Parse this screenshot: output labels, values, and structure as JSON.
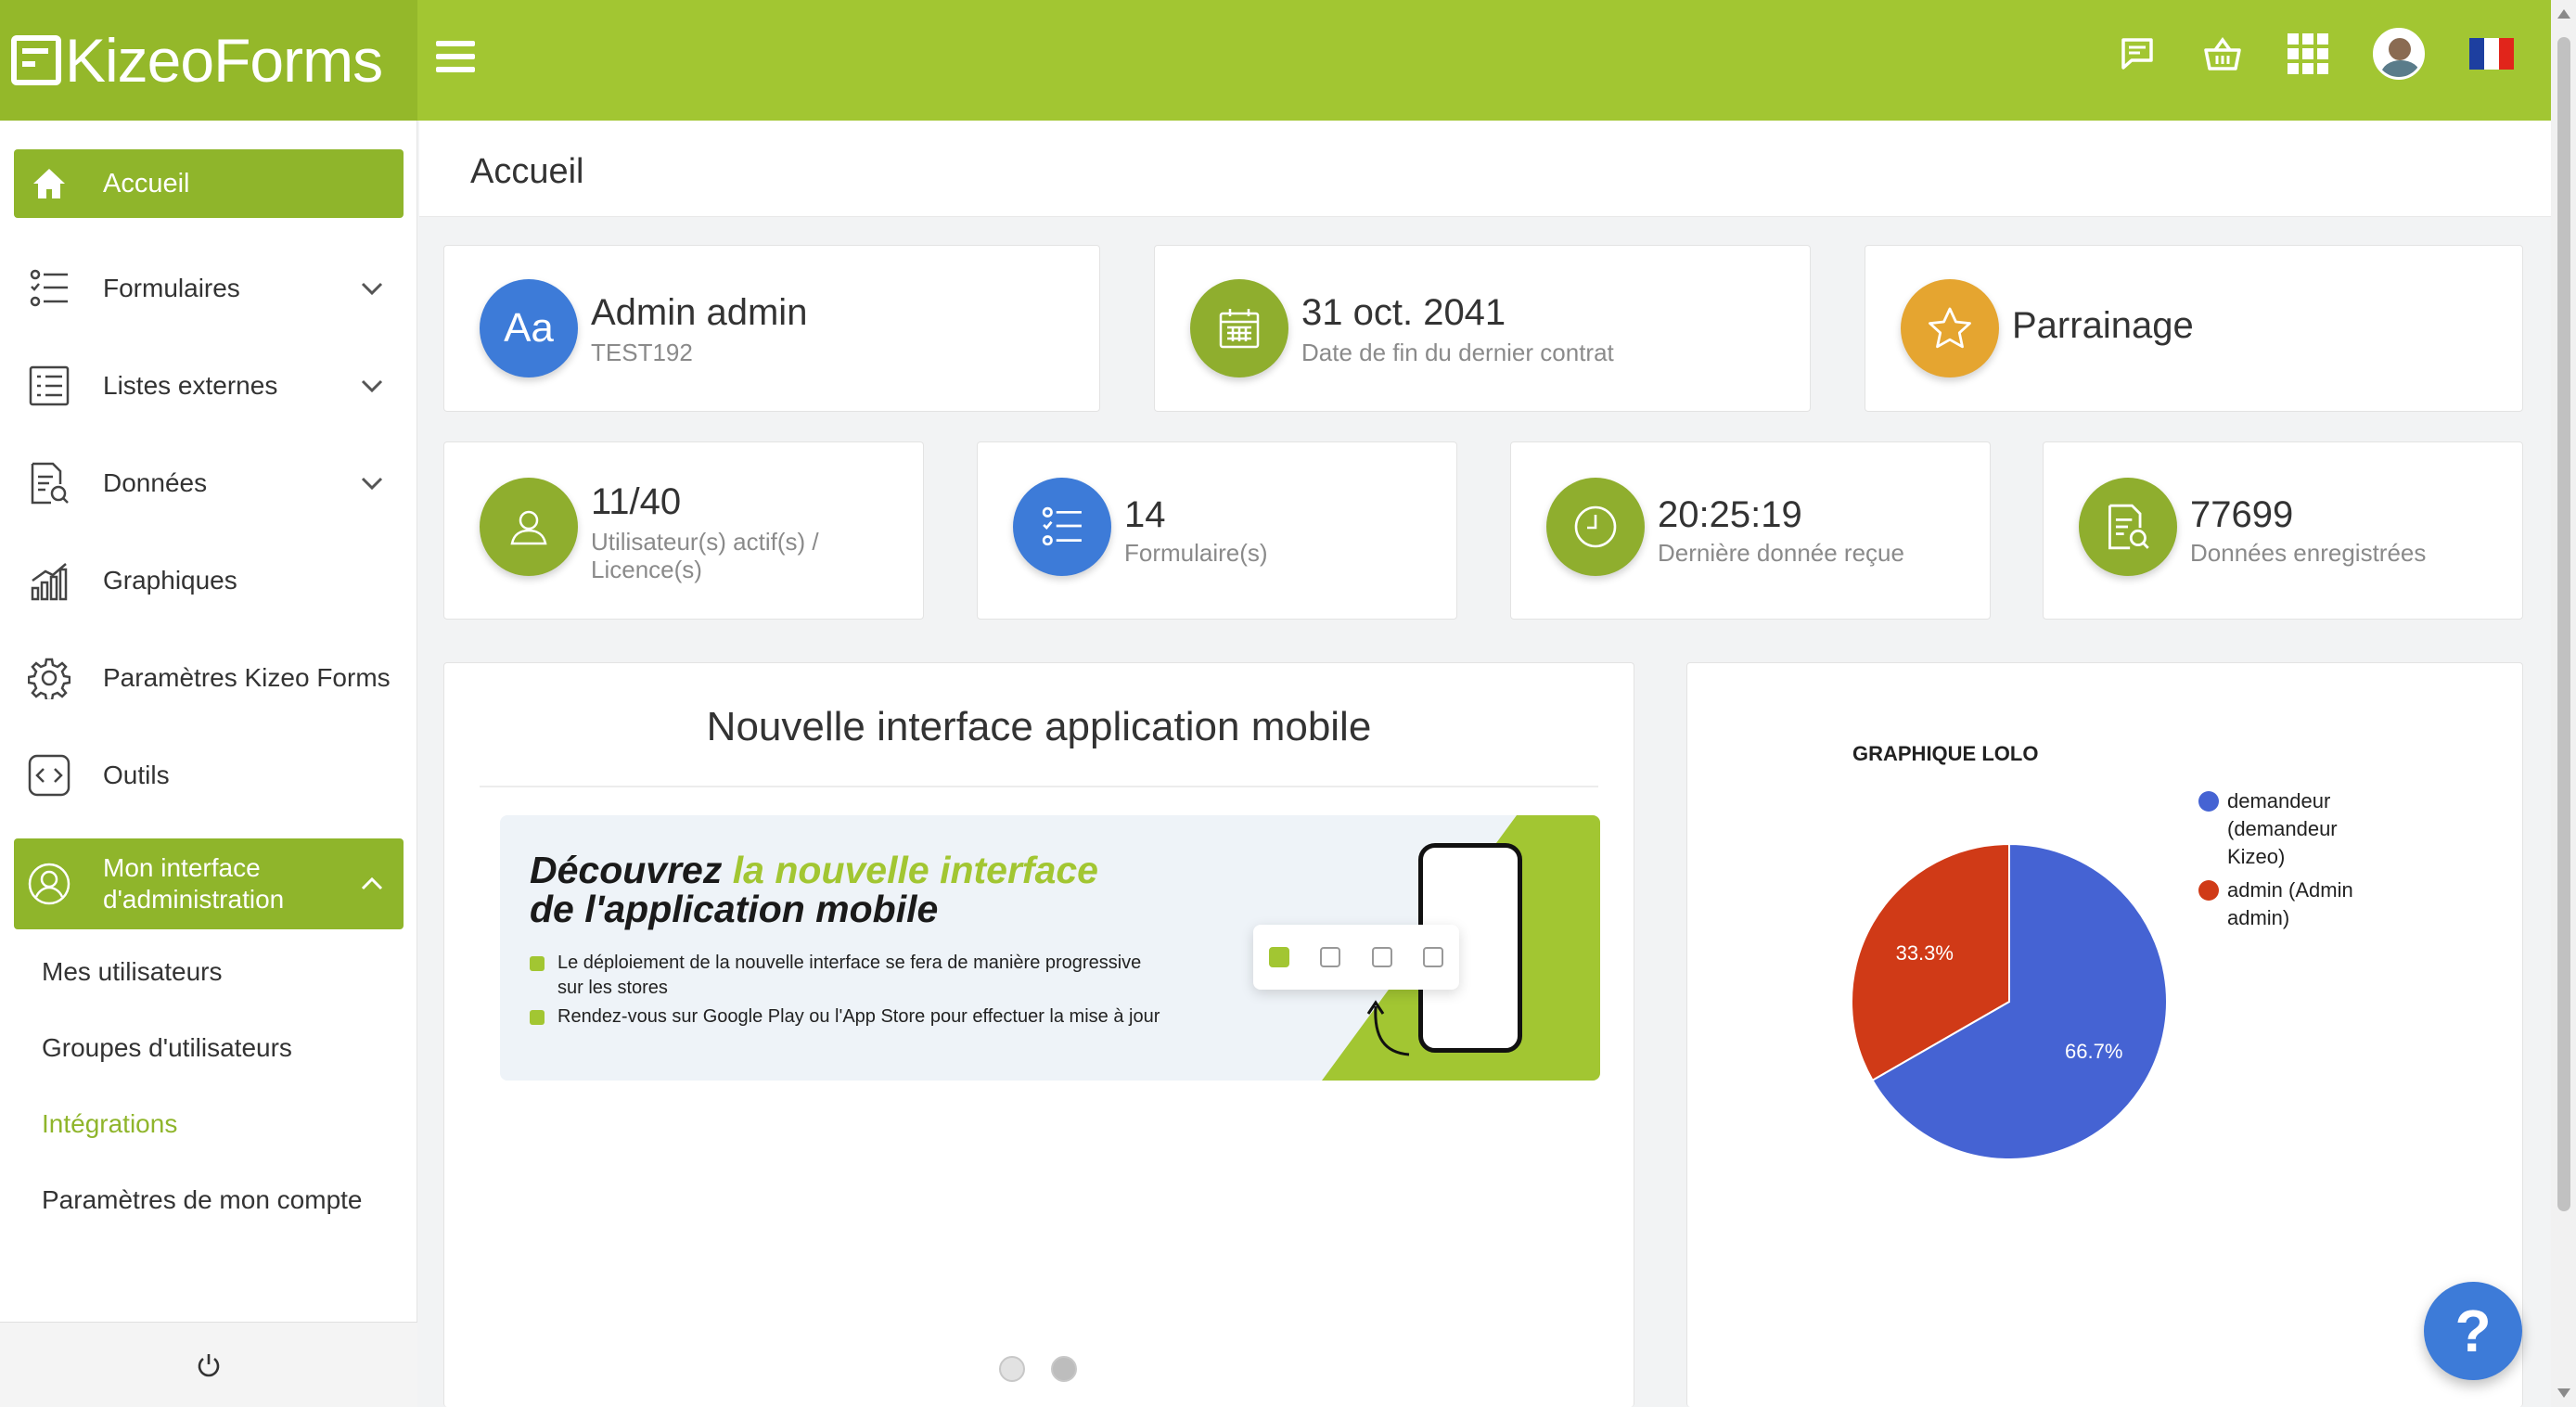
{
  "app": {
    "logo_text": "KizeoForms"
  },
  "header": {
    "icons": [
      "chat-icon",
      "basket-icon",
      "apps-grid-icon",
      "user-avatar",
      "france-flag-icon"
    ],
    "accent": "#a2c632"
  },
  "sidebar": {
    "active_item": "Accueil",
    "items": [
      {
        "label": "Formulaires",
        "icon": "forms-list-icon"
      },
      {
        "label": "Listes externes",
        "icon": "list-icon"
      },
      {
        "label": "Données",
        "icon": "document-search-icon"
      },
      {
        "label": "Graphiques",
        "icon": "bar-chart-icon"
      },
      {
        "label": "Paramètres Kizeo Forms",
        "icon": "gear-icon"
      },
      {
        "label": "Outils",
        "icon": "code-icon"
      }
    ],
    "admin_label_line1": "Mon interface",
    "admin_label_line2": "d'administration",
    "sub_items": [
      "Mes utilisateurs",
      "Groupes d'utilisateurs",
      "Intégrations",
      "Paramètres de mon compte"
    ]
  },
  "page": {
    "title": "Accueil"
  },
  "cards": {
    "user": {
      "avatar_text": "Aa",
      "name": "Admin admin",
      "sub": "TEST192"
    },
    "contract": {
      "date": "31 oct. 2041",
      "sub": "Date de fin du dernier contrat"
    },
    "referral": {
      "label": "Parrainage"
    },
    "users": {
      "value": "11/40",
      "sub_line1": "Utilisateur(s) actif(s) /",
      "sub_line2": "Licence(s)"
    },
    "forms": {
      "value": "14",
      "sub": "Formulaire(s)"
    },
    "last_data": {
      "value": "20:25:19",
      "sub": "Dernière donnée reçue"
    },
    "data_count": {
      "value": "77699",
      "sub": "Données enregistrées"
    }
  },
  "banner": {
    "title": "Nouvelle interface application mobile",
    "headline_part1": "Découvrez ",
    "headline_green": "la nouvelle interface",
    "headline_line2": "de l'application mobile",
    "bullet1_line1": "Le déploiement de la nouvelle interface se fera de manière progressive",
    "bullet1_line2": "sur les stores",
    "bullet2": "Rendez-vous sur Google Play ou l'App Store pour effectuer la mise à jour",
    "carousel_count": 2,
    "carousel_active": 2
  },
  "chart_data": {
    "type": "pie",
    "title": "GRAPHIQUE LOLO",
    "legend_position": "right",
    "slices": [
      {
        "name": "demandeur (demandeur Kizeo)",
        "value": 66.7,
        "label": "66.7%",
        "color": "#4563d3"
      },
      {
        "name": "admin (Admin admin)",
        "value": 33.3,
        "label": "33.3%",
        "color": "#d03a17"
      }
    ],
    "legend": [
      {
        "lines": [
          "demandeur",
          "(demandeur",
          "Kizeo)"
        ],
        "color": "#4563d3"
      },
      {
        "lines": [
          "admin (Admin",
          "admin)"
        ],
        "color": "#d03a17"
      }
    ]
  },
  "help_button": {
    "label": "?"
  }
}
